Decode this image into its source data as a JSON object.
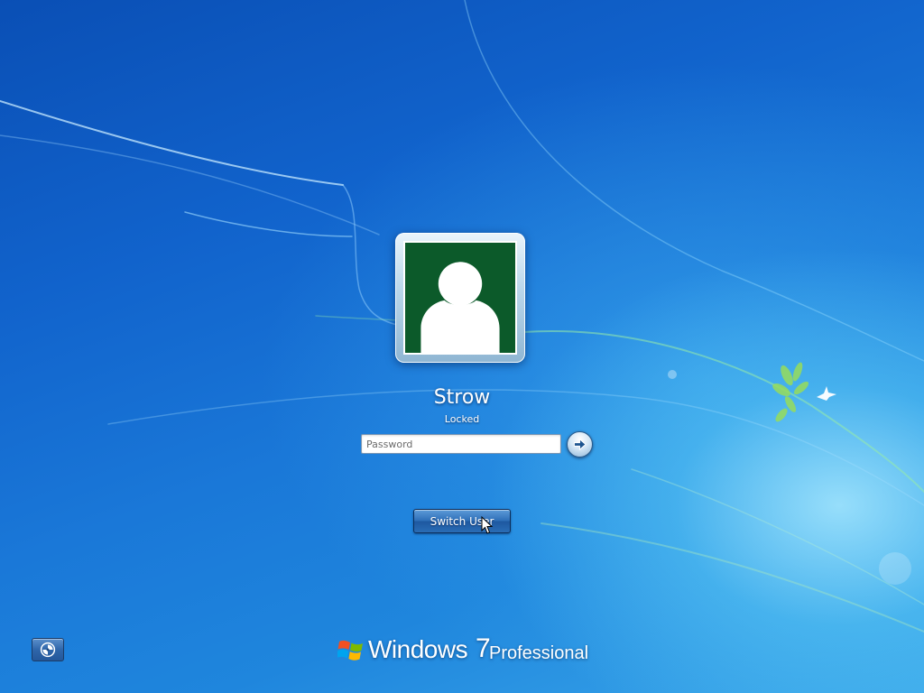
{
  "user": {
    "name": "Strow",
    "status": "Locked"
  },
  "password": {
    "placeholder": "Password",
    "value": ""
  },
  "switch_user_label": "Switch User",
  "branding": {
    "product": "Windows",
    "version": "7",
    "edition": "Professional"
  },
  "icons": {
    "avatar": "user-silhouette-icon",
    "submit": "arrow-right-icon",
    "ease_of_access": "ease-of-access-icon",
    "logo": "windows-flag-icon",
    "cursor": "mouse-cursor-icon"
  },
  "colors": {
    "avatar_bg": "#0c5a2a",
    "background": "#1a78d8"
  }
}
